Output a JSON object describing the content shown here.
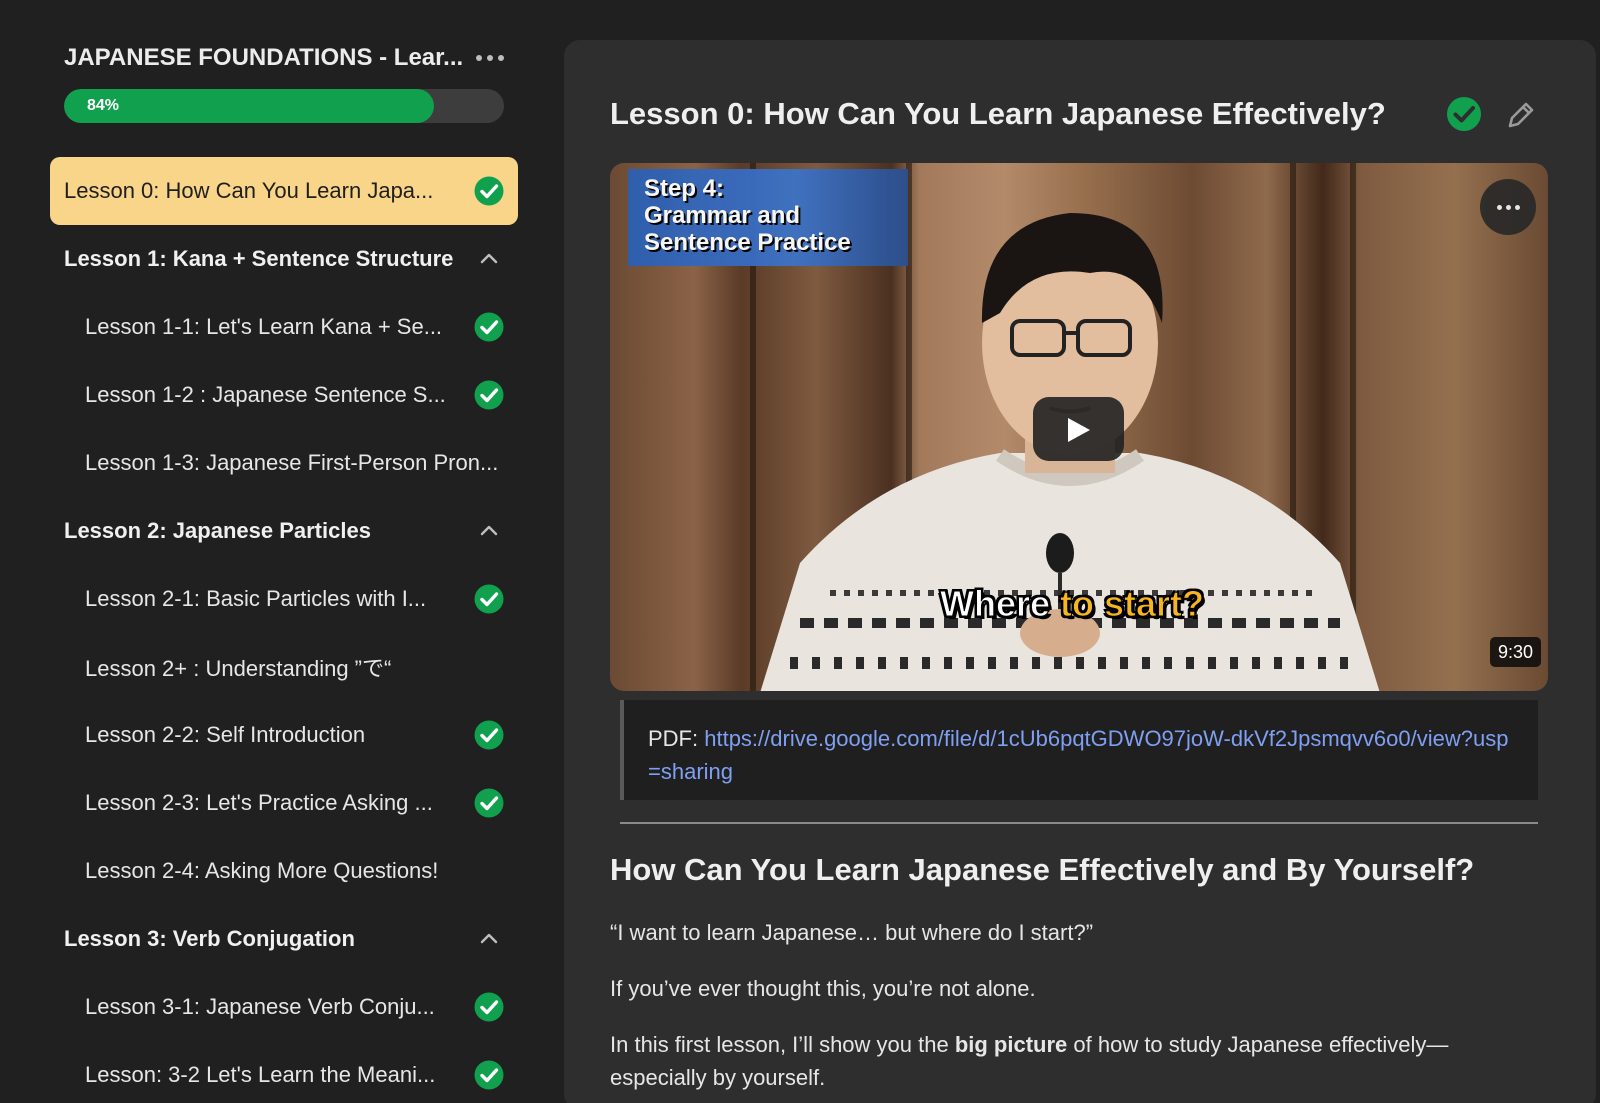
{
  "sidebar": {
    "course_title": "JAPANESE FOUNDATIONS - Lear...",
    "progress": {
      "label": "84%",
      "fraction": 0.84
    },
    "items": [
      {
        "type": "active",
        "label": "Lesson 0: How Can You Learn Japa...",
        "completed": true
      },
      {
        "type": "section",
        "label": "Lesson 1: Kana + Sentence Structure",
        "expanded": true
      },
      {
        "type": "lesson",
        "label": "Lesson 1-1: Let's Learn Kana + Se...",
        "completed": true
      },
      {
        "type": "lesson",
        "label": "Lesson 1-2 : Japanese Sentence S...",
        "completed": true
      },
      {
        "type": "lesson",
        "label": "Lesson 1-3: Japanese First-Person Pron...",
        "completed": false
      },
      {
        "type": "section",
        "label": "Lesson 2: Japanese Particles",
        "expanded": true
      },
      {
        "type": "lesson",
        "label": "Lesson 2-1: Basic Particles with I...",
        "completed": true
      },
      {
        "type": "lesson",
        "label": "Lesson 2+ : Understanding ”で“",
        "completed": false
      },
      {
        "type": "lesson",
        "label": "Lesson 2-2: Self Introduction",
        "completed": true
      },
      {
        "type": "lesson",
        "label": "Lesson 2-3: Let's Practice Asking ...",
        "completed": true
      },
      {
        "type": "lesson",
        "label": "Lesson 2-4: Asking More Questions!",
        "completed": false
      },
      {
        "type": "section",
        "label": "Lesson 3: Verb Conjugation",
        "expanded": true
      },
      {
        "type": "lesson",
        "label": "Lesson 3-1: Japanese Verb Conju...",
        "completed": true
      },
      {
        "type": "lesson",
        "label": "Lesson: 3-2 Let's Learn the Meani...",
        "completed": true
      }
    ]
  },
  "main": {
    "lesson_title": "Lesson 0: How Can You Learn Japanese Effectively?",
    "video": {
      "step_lines": [
        "Step 4:",
        "Grammar and",
        "Sentence Practice"
      ],
      "caption_white": "Where ",
      "caption_yellow": "to start?",
      "duration": "9:30"
    },
    "pdf": {
      "prefix": "PDF: ",
      "url": "https://drive.google.com/file/d/1cUb6pqtGDWO97joW-dkVf2Jpsmqvv6o0/view?usp=sharing"
    },
    "heading": "How Can You Learn Japanese Effectively and By Yourself?",
    "para1": "“I want to learn Japanese… but where do I start?”",
    "para2": "If you’ve ever thought this, you’re not alone.",
    "para3_pre": "In this first lesson, I’ll show you the ",
    "para3_bold": "big picture",
    "para3_post": " of how to study Japanese effectively—",
    "para4": "especially by yourself."
  },
  "colors": {
    "accent_green": "#11a14e",
    "active_item": "#f9d58a",
    "link": "#7f9ff2",
    "caption_yellow": "#f6b521"
  }
}
